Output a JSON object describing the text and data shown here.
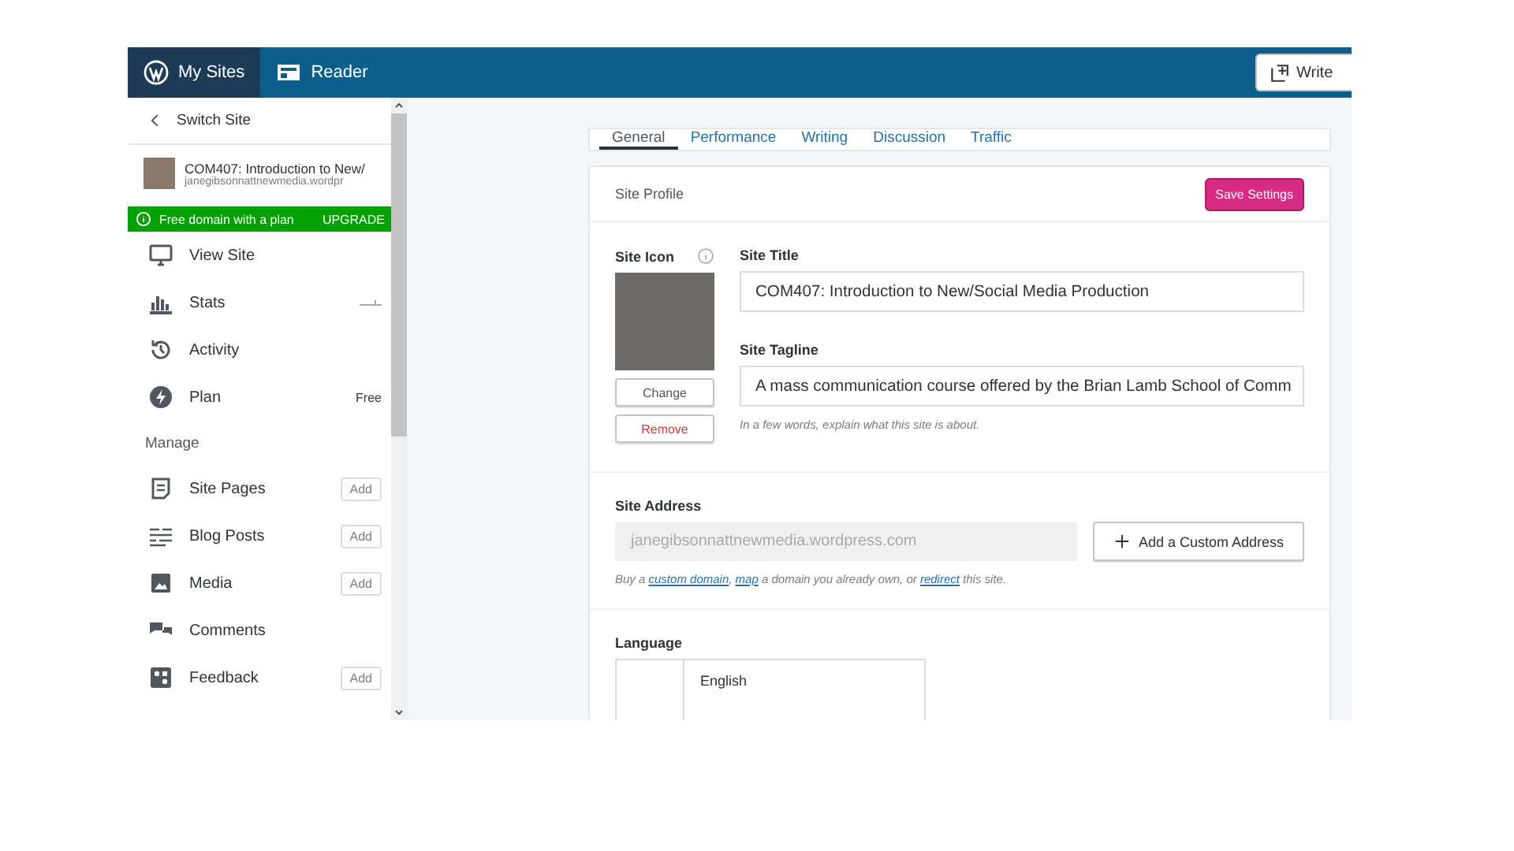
{
  "top_bar": {
    "items": [
      {
        "label": "My Sites",
        "selected": true
      },
      {
        "label": "Reader",
        "selected": false
      }
    ],
    "write_button": "Write"
  },
  "sidebar": {
    "switch_site": "Switch Site",
    "site": {
      "title": "COM407: Introduction to New/",
      "url": "janegibsonnattnewmedia.wordpr"
    },
    "notice": {
      "text": "Free domain with a plan",
      "action": "UPGRADE"
    },
    "items": [
      {
        "kind": "link",
        "label": "View Site"
      },
      {
        "kind": "stats",
        "label": "Stats"
      },
      {
        "kind": "link",
        "label": "Activity"
      },
      {
        "kind": "badge",
        "label": "Plan",
        "badge": "Free"
      }
    ],
    "section": "Manage",
    "manage_items": [
      {
        "kind": "add",
        "label": "Site Pages",
        "action": "Add"
      },
      {
        "kind": "add",
        "label": "Blog Posts",
        "action": "Add"
      },
      {
        "kind": "add",
        "label": "Media",
        "action": "Add"
      },
      {
        "kind": "link",
        "label": "Comments"
      },
      {
        "kind": "add",
        "label": "Feedback",
        "action": "Add"
      }
    ]
  },
  "main": {
    "tabs": [
      {
        "label": "General",
        "selected": true
      },
      {
        "label": "Performance",
        "selected": false
      },
      {
        "label": "Writing",
        "selected": false
      },
      {
        "label": "Discussion",
        "selected": false
      },
      {
        "label": "Traffic",
        "selected": false
      }
    ],
    "profile": {
      "header": "Site Profile",
      "save_button": "Save Settings",
      "icon_label": "Site Icon",
      "change_button": "Change",
      "remove_button": "Remove",
      "title_label": "Site Title",
      "title_value": "COM407: Introduction to New/Social Media Production",
      "tagline_label": "Site Tagline",
      "tagline_value": "A mass communication course offered by the Brian Lamb School of Comm",
      "tagline_hint": "In a few words, explain what this site is about."
    },
    "address": {
      "label": "Site Address",
      "value": "janegibsonnattnewmedia.wordpress.com",
      "add_button": "Add a Custom Address",
      "hint": [
        {
          "kind": "text",
          "text": "Buy a "
        },
        {
          "kind": "link",
          "text": "custom domain"
        },
        {
          "kind": "text",
          "text": ", "
        },
        {
          "kind": "link",
          "text": "map"
        },
        {
          "kind": "text",
          "text": " a domain you already own, or "
        },
        {
          "kind": "link",
          "text": "redirect"
        },
        {
          "kind": "text",
          "text": " this site."
        }
      ]
    },
    "language": {
      "label": "Language",
      "value": "English"
    }
  }
}
